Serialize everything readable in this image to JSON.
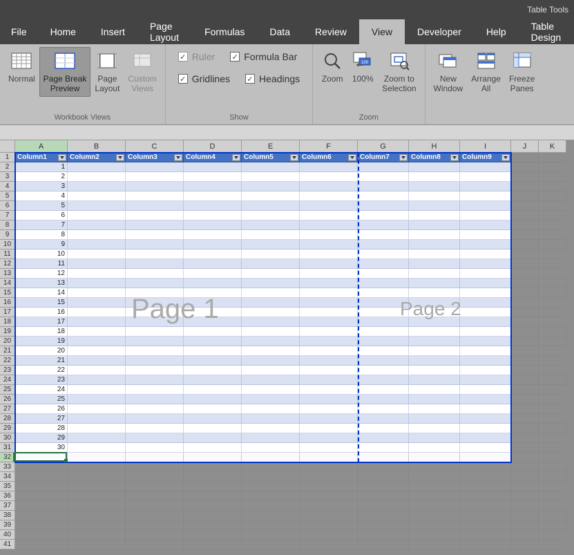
{
  "titlebar": {
    "tool_context": "Table Tools"
  },
  "tabs": {
    "file": "File",
    "home": "Home",
    "insert": "Insert",
    "page_layout": "Page Layout",
    "formulas": "Formulas",
    "data": "Data",
    "review": "Review",
    "view": "View",
    "developer": "Developer",
    "help": "Help",
    "table_design": "Table Design"
  },
  "ribbon": {
    "workbook_views": {
      "label": "Workbook Views",
      "normal": "Normal",
      "page_break": "Page Break\nPreview",
      "page_layout": "Page\nLayout",
      "custom_views": "Custom\nViews"
    },
    "show": {
      "label": "Show",
      "ruler": "Ruler",
      "formula_bar": "Formula Bar",
      "gridlines": "Gridlines",
      "headings": "Headings"
    },
    "zoom": {
      "label": "Zoom",
      "zoom": "Zoom",
      "hundred": "100%",
      "zoom_to_selection": "Zoom to\nSelection"
    },
    "window": {
      "new_window": "New\nWindow",
      "arrange_all": "Arrange\nAll",
      "freeze_panes": "Freeze\nPanes"
    }
  },
  "columns": [
    "A",
    "B",
    "C",
    "D",
    "E",
    "F",
    "G",
    "H",
    "I",
    "J",
    "K"
  ],
  "table_headers": [
    "Column1",
    "Column2",
    "Column3",
    "Column4",
    "Column5",
    "Column6",
    "Column7",
    "Column8",
    "Column9"
  ],
  "data_col_a": [
    "1",
    "2",
    "3",
    "4",
    "5",
    "6",
    "7",
    "8",
    "9",
    "10",
    "11",
    "12",
    "13",
    "14",
    "15",
    "16",
    "17",
    "18",
    "19",
    "20",
    "21",
    "22",
    "23",
    "24",
    "25",
    "26",
    "27",
    "28",
    "29",
    "30"
  ],
  "row_count": 41,
  "watermarks": {
    "p1": "Page 1",
    "p2": "Page 2"
  },
  "active_cell": "A32"
}
